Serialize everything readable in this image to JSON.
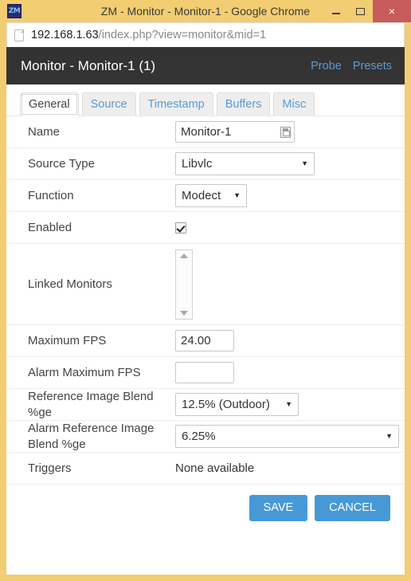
{
  "window": {
    "title": "ZM - Monitor - Monitor-1 - Google Chrome",
    "favicon_label": "ZM",
    "controls": {
      "minimize": "minimize-icon",
      "maximize": "maximize-icon",
      "close": "×"
    }
  },
  "address_bar": {
    "host": "192.168.1.63",
    "path": "/index.php?view=monitor&mid=1",
    "page_icon": "page-icon"
  },
  "app_header": {
    "title": "Monitor - Monitor-1 (1)",
    "links": [
      {
        "label": "Probe"
      },
      {
        "label": "Presets"
      }
    ]
  },
  "tabs": [
    {
      "label": "General",
      "active": true
    },
    {
      "label": "Source",
      "active": false
    },
    {
      "label": "Timestamp",
      "active": false
    },
    {
      "label": "Buffers",
      "active": false
    },
    {
      "label": "Misc",
      "active": false
    }
  ],
  "form": {
    "name": {
      "label": "Name",
      "value": "Monitor-1",
      "placeholder": ""
    },
    "source_type": {
      "label": "Source Type",
      "value": "Libvlc"
    },
    "function": {
      "label": "Function",
      "value": "Modect"
    },
    "enabled": {
      "label": "Enabled",
      "checked": true
    },
    "linked_monitors": {
      "label": "Linked Monitors",
      "value": ""
    },
    "maximum_fps": {
      "label": "Maximum FPS",
      "value": "24.00",
      "placeholder": ""
    },
    "alarm_maximum_fps": {
      "label": "Alarm Maximum FPS",
      "value": "",
      "placeholder": ""
    },
    "reference_image_blend": {
      "label": "Reference Image Blend %ge",
      "value": "12.5% (Outdoor)"
    },
    "alarm_reference_image_blend": {
      "label": "Alarm Reference Image Blend %ge",
      "value": "6.25%"
    },
    "triggers": {
      "label": "Triggers",
      "value": "None available"
    }
  },
  "actions": {
    "save_label": "SAVE",
    "cancel_label": "CANCEL"
  },
  "colors": {
    "window_chrome": "#f2cd72",
    "close_button": "#c75b5b",
    "app_header_bg": "#333333",
    "link_blue": "#5b9bd5",
    "button_blue": "#4699d6"
  }
}
